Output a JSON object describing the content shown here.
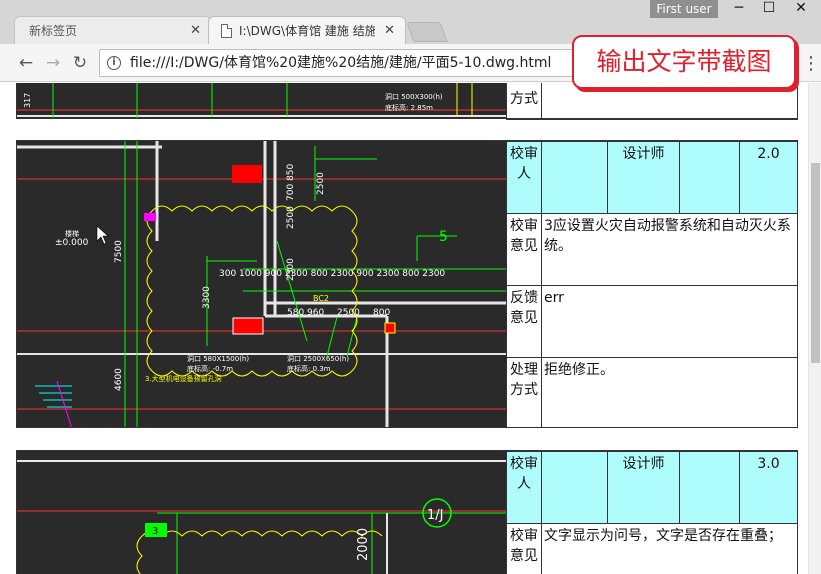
{
  "window": {
    "user_label": "First user",
    "minimize": "─",
    "maximize": "☐",
    "close": "✕"
  },
  "tabs": [
    {
      "title": "新标签页",
      "close": "✕"
    },
    {
      "title": "I:\\DWG\\体育馆 建施 结施",
      "close": "✕"
    }
  ],
  "toolbar": {
    "back_icon": "←",
    "forward_icon": "→",
    "reload_icon": "↻",
    "info_icon": "i",
    "url": "file:///I:/DWG/体育馆%20建施%20结施/建施/平面5-10.dwg.html",
    "menu_icon": "⋮"
  },
  "callout": "输出文字带截图",
  "rows": [
    {
      "bottom_label": "方式",
      "cad_texts": {
        "a": "317",
        "b": "洞口 500X300(h)",
        "c": "底标高: 2.85m"
      }
    },
    {
      "reviewer_label": "校审人",
      "reviewer_name": "设计师",
      "version": "2.0",
      "opinion_label": "校审意见",
      "opinion": "3应设置火灾自动报警系统和自动灭火系统。",
      "feedback_label": "反馈意见",
      "feedback": "err",
      "handling_label": "处理方式",
      "handling": "拒绝修正。",
      "cad_texts": {
        "elev_label": "楼梯",
        "elev": "±0.000",
        "d7500": "7500",
        "d3300": "3300",
        "d4600": "4600",
        "d700": "700 850",
        "d2500a": "2500",
        "d2500b": "2500",
        "d2300": "2300",
        "five": "5",
        "dims": "300  1000 900  2300   800   2300  900   2300   800   2300",
        "bc2": "BC2",
        "d580": "580 960",
        "d2500c": "2500",
        "d800": "800",
        "h1": "洞口 580X1500(h)",
        "h2": "底标高: -0.7m",
        "h3": "洞口 2500X650(h)",
        "h4": "底标高: 0.3m",
        "note": "3.大型机电设备预留孔洞"
      }
    },
    {
      "reviewer_label": "校审人",
      "reviewer_name": "设计师",
      "version": "3.0",
      "opinion_label": "校审意见",
      "opinion": "文字显示为问号，文字是否存在重叠；",
      "cad_texts": {
        "three": "3",
        "d2000": "2000",
        "axis": "1/J"
      }
    }
  ]
}
